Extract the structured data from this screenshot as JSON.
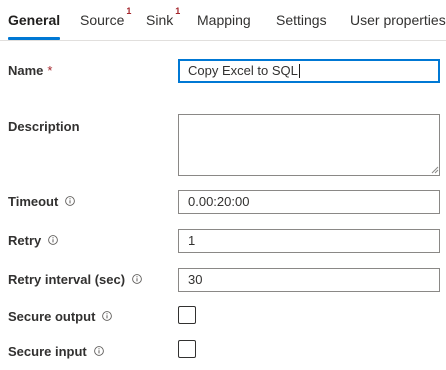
{
  "tabs": [
    {
      "label": "General",
      "badge": ""
    },
    {
      "label": "Source",
      "badge": "1"
    },
    {
      "label": "Sink",
      "badge": "1"
    },
    {
      "label": "Mapping",
      "badge": ""
    },
    {
      "label": "Settings",
      "badge": ""
    },
    {
      "label": "User properties",
      "badge": ""
    }
  ],
  "active_tab": "General",
  "form": {
    "name": {
      "label": "Name",
      "required_mark": "*",
      "value": "Copy Excel to SQL"
    },
    "description": {
      "label": "Description",
      "value": ""
    },
    "timeout": {
      "label": "Timeout",
      "value": "0.00:20:00"
    },
    "retry": {
      "label": "Retry",
      "value": "1"
    },
    "retry_interval": {
      "label": "Retry interval (sec)",
      "value": "30"
    },
    "secure_output": {
      "label": "Secure output",
      "checked": false
    },
    "secure_input": {
      "label": "Secure input",
      "checked": false
    }
  },
  "icons": {
    "info": "info-icon",
    "resize": "resize-grip-icon"
  },
  "colors": {
    "accent": "#0078d4",
    "badge": "#a4262c",
    "required": "#a4262c",
    "border": "#8a8886"
  }
}
